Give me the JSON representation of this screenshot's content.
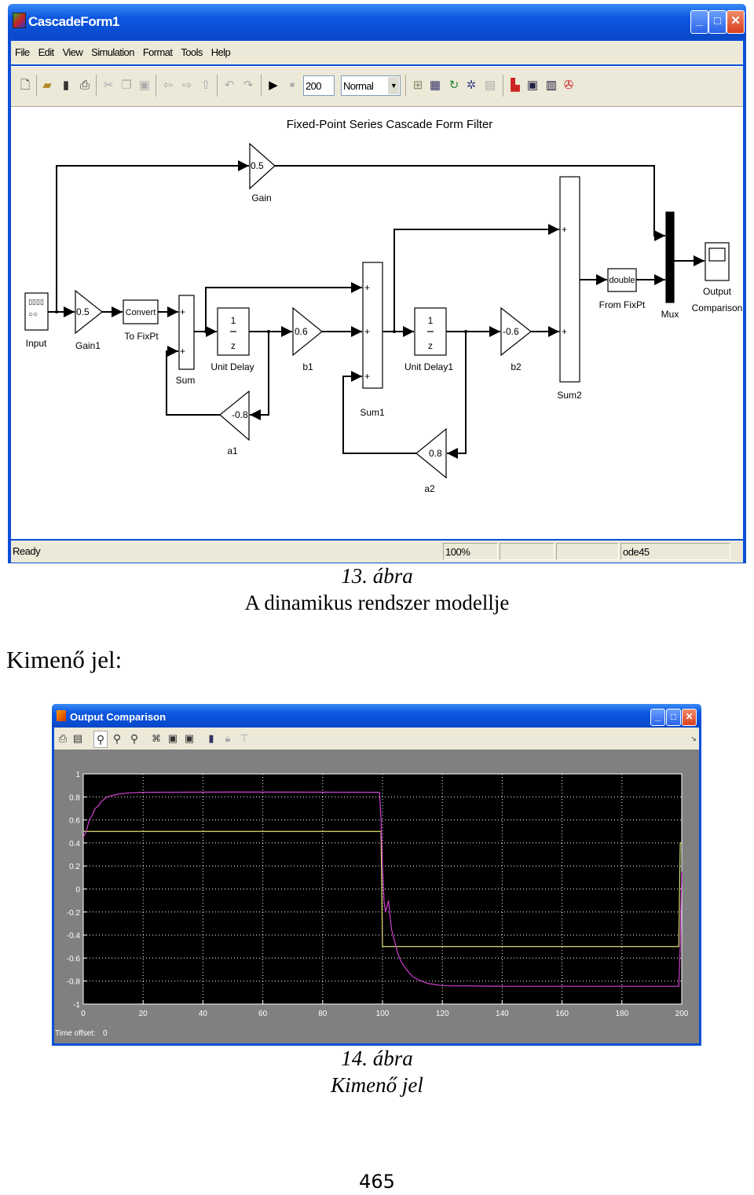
{
  "simulink_window": {
    "title": "CascadeForm1",
    "menu": [
      "File",
      "Edit",
      "View",
      "Simulation",
      "Format",
      "Tools",
      "Help"
    ],
    "toolbar": {
      "icons": [
        "new-icon",
        "open-icon",
        "save-icon",
        "print-icon",
        "cut-icon",
        "copy-icon",
        "paste-icon",
        "back-icon",
        "forward-icon",
        "up-icon",
        "undo-icon",
        "redo-icon",
        "play-icon",
        "stop-icon"
      ],
      "stop_time": "200",
      "sim_mode": "Normal",
      "icons_right": [
        "build-icon",
        "model-browser-icon",
        "update-diagram-icon",
        "debug-icon",
        "library-icon",
        "explorer-icon",
        "model-explorer-icon",
        "port-icon",
        "fixed-point-icon"
      ]
    },
    "diagram": {
      "title": "Fixed-Point Series Cascade Form Filter",
      "blocks": {
        "gain": {
          "value": "0.5",
          "label": "Gain"
        },
        "input": {
          "label": "Input",
          "glyph_top": "▯▯▯▯",
          "glyph_bottom": "○○"
        },
        "gain1": {
          "value": "0.5",
          "label": "Gain1"
        },
        "convert": {
          "text": "Convert",
          "label": "To FixPt"
        },
        "sum": {
          "label": "Sum",
          "signs": [
            "+",
            "+"
          ]
        },
        "unit_delay": {
          "num": "1",
          "den": "z",
          "label": "Unit Delay"
        },
        "b1": {
          "value": "0.6",
          "label": "b1"
        },
        "a1": {
          "value": "-0.8",
          "label": "a1"
        },
        "sum1": {
          "label": "Sum1",
          "signs": [
            "+",
            "+",
            "+"
          ]
        },
        "unit_delay1": {
          "num": "1",
          "den": "z",
          "label": "Unit Delay1"
        },
        "b2": {
          "value": "-0.6",
          "label": "b2"
        },
        "a2": {
          "value": "0.8",
          "label": "a2"
        },
        "sum2": {
          "label": "Sum2",
          "signs": [
            "+",
            "+"
          ]
        },
        "from_fixpt": {
          "text": "double",
          "label": "From FixPt"
        },
        "mux": {
          "label": "Mux"
        },
        "scope": {
          "label_line1": "Output",
          "label_line2": "Comparison"
        }
      }
    },
    "status": {
      "state": "Ready",
      "zoom": "100%",
      "blank": "",
      "solver": "ode45"
    }
  },
  "caption13": {
    "number": "13. ábra",
    "text": "A dinamikus rendszer modellje"
  },
  "section_label": "Kimenő jel:",
  "scope_window": {
    "title": "Output Comparison",
    "toolbar_icons": [
      "print-icon",
      "parameters-icon",
      "zoom-icon",
      "zoom-x-icon",
      "zoom-y-icon",
      "autoscale-icon",
      "save-axes-icon",
      "restore-axes-icon",
      "floating-scope-icon",
      "lock-icon",
      "signal-selection-icon"
    ],
    "time_offset_label": "Time offset:",
    "time_offset_value": "0"
  },
  "chart_data": {
    "type": "line",
    "title": "",
    "xlabel": "",
    "ylabel": "",
    "xlim": [
      0,
      200
    ],
    "ylim": [
      -1,
      1
    ],
    "xticks": [
      "0",
      "20",
      "40",
      "60",
      "80",
      "100",
      "120",
      "140",
      "160",
      "180",
      "200"
    ],
    "yticks": [
      "1",
      "0.8",
      "0.6",
      "0.4",
      "0.2",
      "0",
      "-0.2",
      "-0.4",
      "-0.6",
      "-0.8",
      "-1"
    ],
    "grid": true,
    "background": "#000000",
    "series": [
      {
        "color": "#e0e070",
        "points": [
          [
            0,
            0.5
          ],
          [
            99.5,
            0.5
          ],
          [
            100,
            -0.5
          ],
          [
            199,
            -0.5
          ],
          [
            199.5,
            0.4
          ],
          [
            200,
            0.4
          ]
        ]
      },
      {
        "color": "#d040d0",
        "points": [
          [
            0,
            0.45
          ],
          [
            1,
            0.5
          ],
          [
            2,
            0.6
          ],
          [
            3,
            0.64
          ],
          [
            4,
            0.7
          ],
          [
            5,
            0.72
          ],
          [
            6,
            0.76
          ],
          [
            7,
            0.78
          ],
          [
            8,
            0.8
          ],
          [
            10,
            0.815
          ],
          [
            12,
            0.825
          ],
          [
            15,
            0.835
          ],
          [
            20,
            0.84
          ],
          [
            50,
            0.842
          ],
          [
            99,
            0.84
          ],
          [
            99.5,
            0.6
          ],
          [
            100,
            0.2
          ],
          [
            100.5,
            -0.1
          ],
          [
            101,
            -0.2
          ],
          [
            102,
            -0.1
          ],
          [
            103,
            -0.35
          ],
          [
            104,
            -0.45
          ],
          [
            105,
            -0.55
          ],
          [
            106,
            -0.62
          ],
          [
            108,
            -0.7
          ],
          [
            110,
            -0.76
          ],
          [
            112,
            -0.79
          ],
          [
            115,
            -0.82
          ],
          [
            120,
            -0.84
          ],
          [
            140,
            -0.845
          ],
          [
            199,
            -0.845
          ],
          [
            199.5,
            -0.5
          ],
          [
            200,
            0.15
          ]
        ]
      }
    ]
  },
  "caption14": {
    "number": "14. ábra",
    "text": "Kimenő jel"
  },
  "page_number": "465"
}
